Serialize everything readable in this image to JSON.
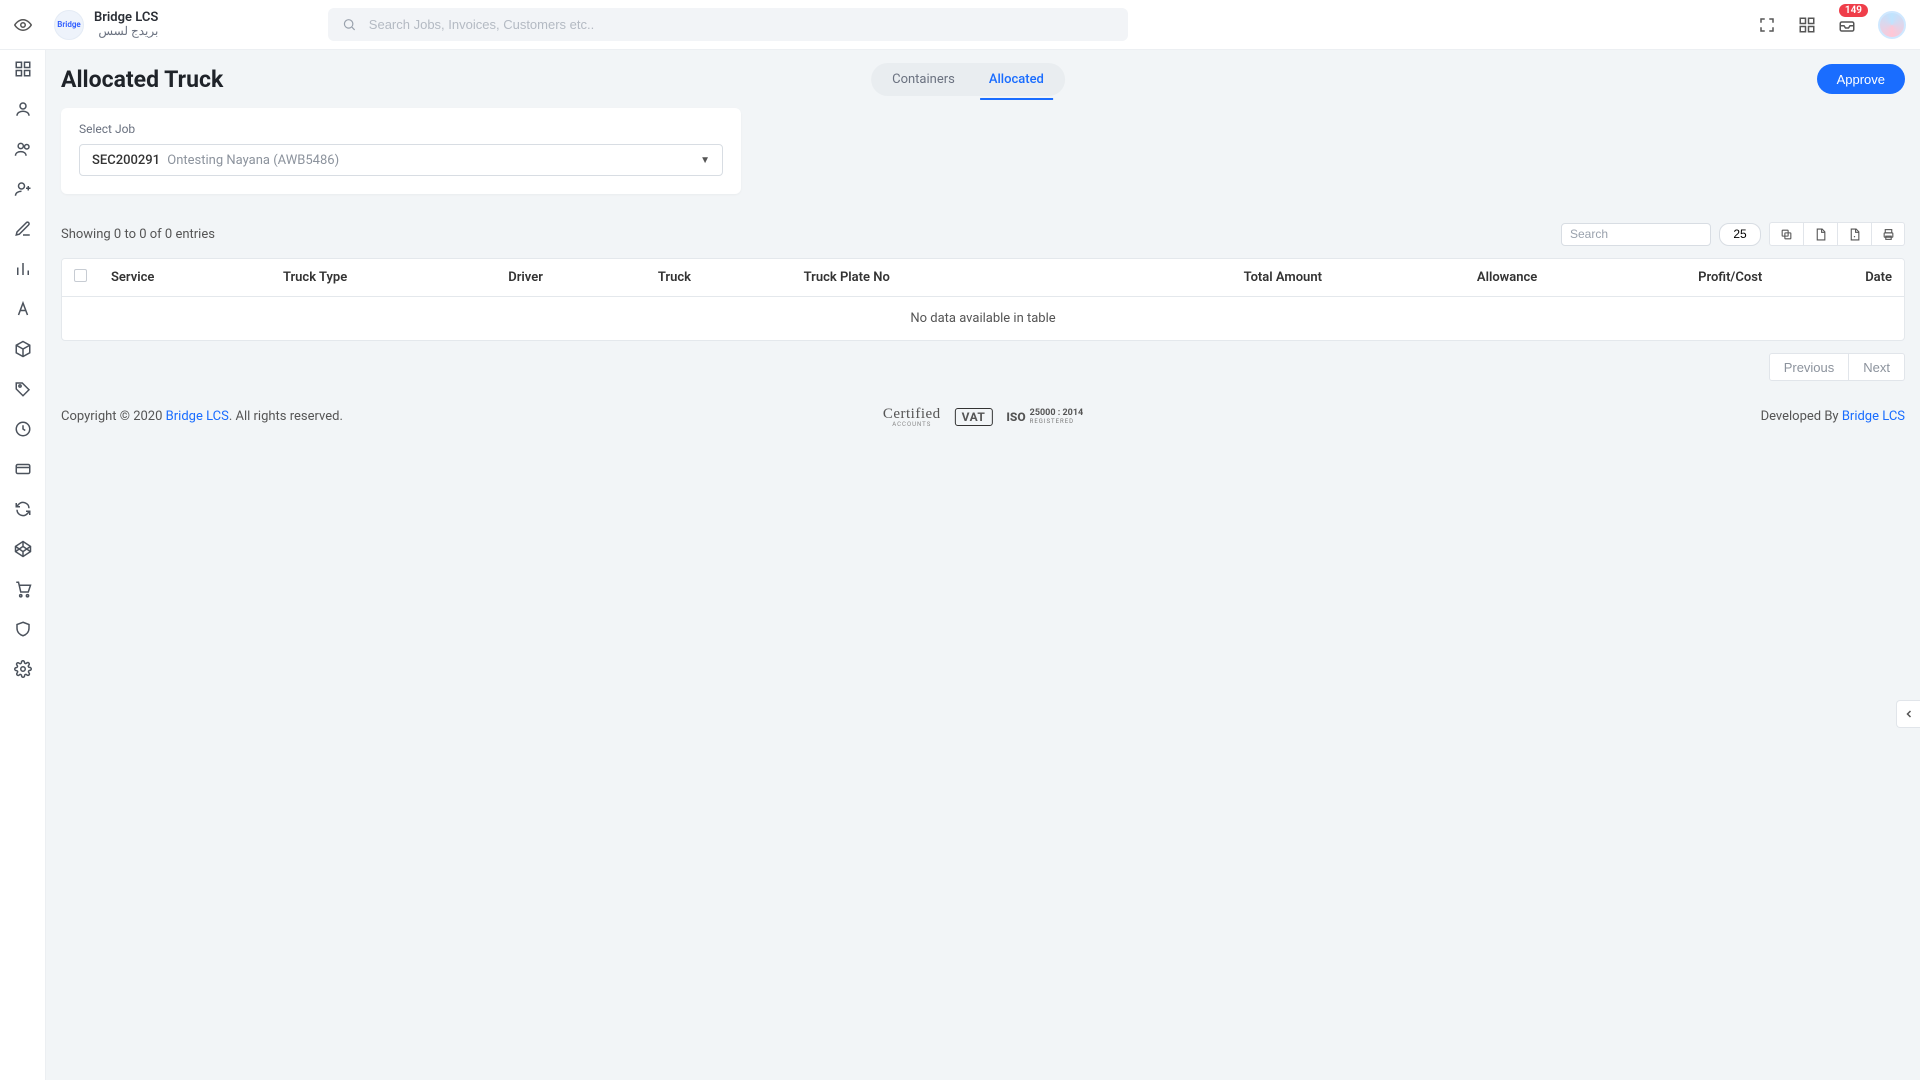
{
  "header": {
    "brand_en": "Bridge LCS",
    "brand_ar": "بريدج لسس",
    "logo_text": "Bridge",
    "search_placeholder": "Search Jobs, Invoices, Customers etc..",
    "notif_count": "149"
  },
  "page": {
    "title": "Allocated Truck",
    "tabs": {
      "containers": "Containers",
      "allocated": "Allocated"
    },
    "approve": "Approve"
  },
  "filter": {
    "label": "Select Job",
    "job_code": "SEC200291",
    "job_desc": "Ontesting Nayana (AWB5486)"
  },
  "table": {
    "showing": "Showing 0 to 0 of 0 entries",
    "search_placeholder": "Search",
    "pagesize": "25",
    "cols": {
      "service": "Service",
      "truck_type": "Truck Type",
      "driver": "Driver",
      "truck": "Truck",
      "plate": "Truck Plate No",
      "total": "Total Amount",
      "allowance": "Allowance",
      "profit": "Profit/Cost",
      "date": "Date"
    },
    "empty": "No data available in table",
    "prev": "Previous",
    "next": "Next"
  },
  "footer": {
    "copyright_pre": "Copyright © 2020 ",
    "brand": "Bridge LCS",
    "copyright_post": ". All rights reserved.",
    "certified": "Certified",
    "certified_sub": "ACCOUNTS",
    "vat": "VAT",
    "iso": "ISO",
    "iso_num": "25000 : 2014",
    "iso_reg": "REGISTERED",
    "dev_pre": "Developed By ",
    "dev_brand": "Bridge LCS"
  }
}
